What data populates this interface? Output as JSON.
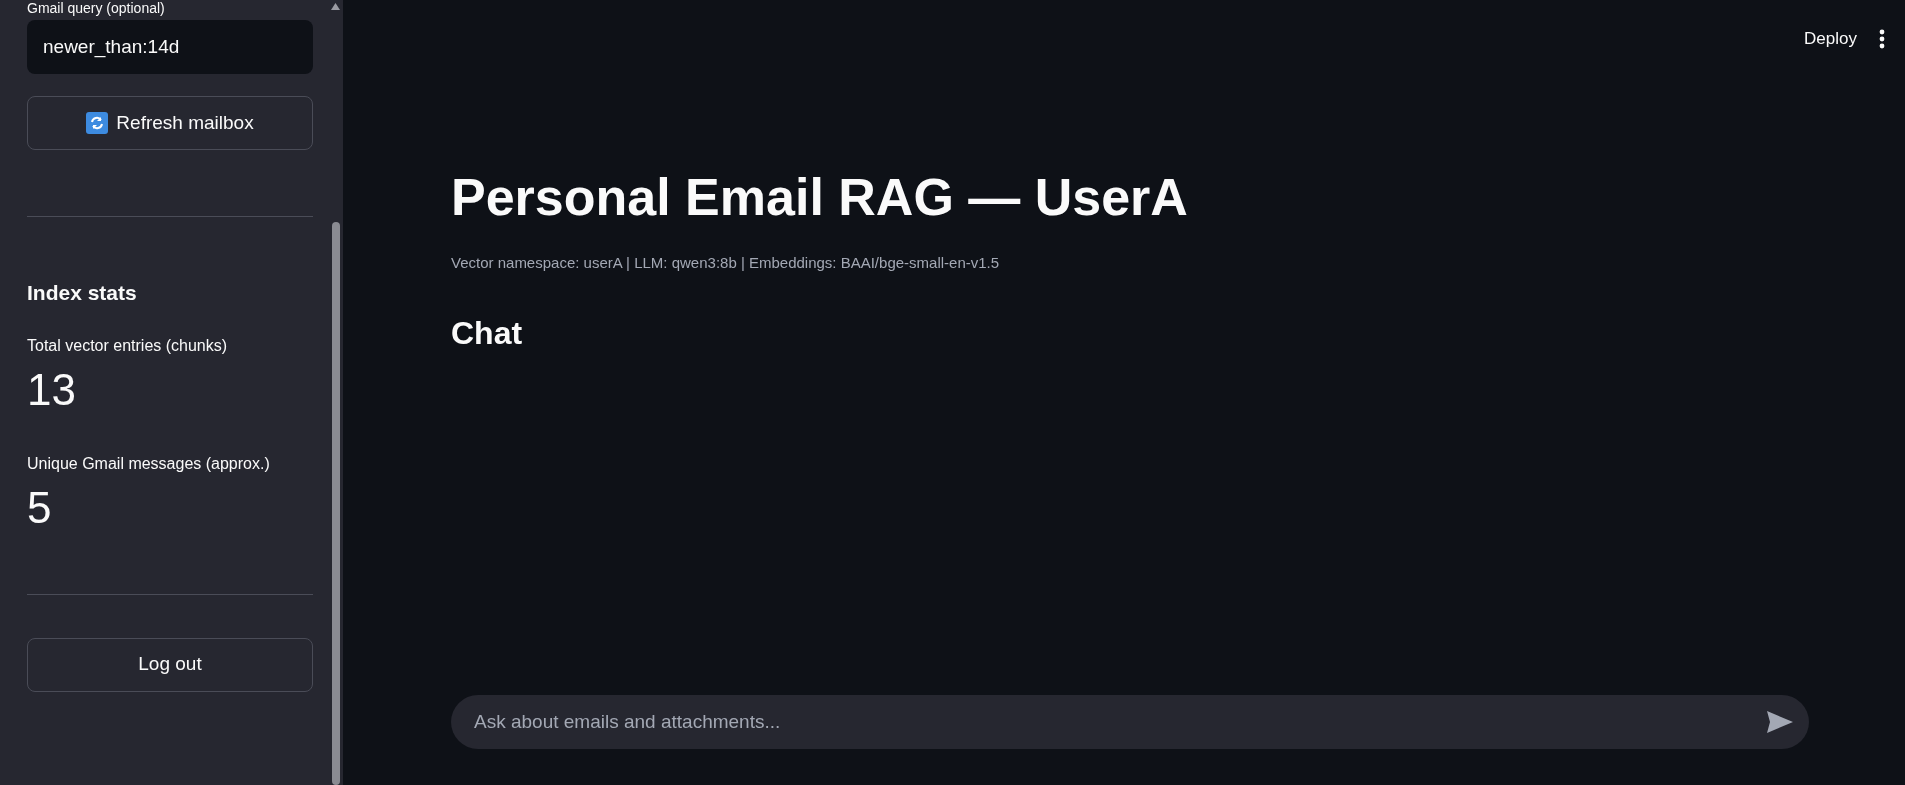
{
  "sidebar": {
    "query_field": {
      "label": "Gmail query (optional)",
      "value": "newer_than:14d"
    },
    "refresh_button": {
      "label": "Refresh mailbox"
    },
    "stats_heading": "Index stats",
    "metrics": [
      {
        "label": "Total vector entries (chunks)",
        "value": "13"
      },
      {
        "label": "Unique Gmail messages (approx.)",
        "value": "5"
      }
    ],
    "logout_button": {
      "label": "Log out"
    }
  },
  "header": {
    "deploy_button": "Deploy"
  },
  "main": {
    "title": "Personal Email RAG — UserA",
    "caption": "Vector namespace: userA | LLM: qwen3:8b | Embeddings: BAAI/bge-small-en-v1.5",
    "chat_heading": "Chat",
    "chat_input": {
      "placeholder": "Ask about emails and attachments..."
    }
  }
}
